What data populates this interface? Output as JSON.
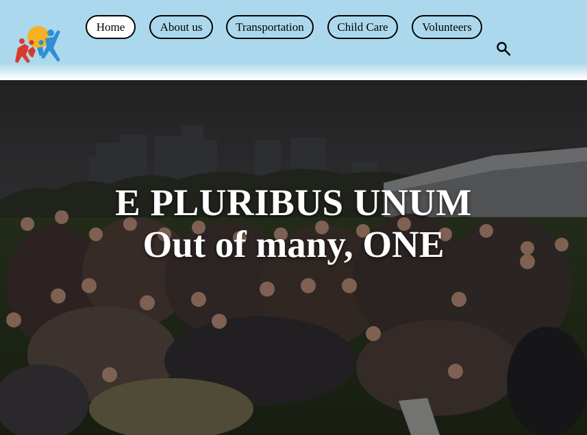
{
  "header": {
    "background": "#abd8ec",
    "logo": {
      "icon": "family-logo-icon",
      "colors": [
        "#f5b324",
        "#d93a2e",
        "#2f8fd6"
      ]
    },
    "nav": [
      {
        "label": "Home",
        "active": true
      },
      {
        "label": "About us",
        "active": false
      },
      {
        "label": "Transportation",
        "active": false
      },
      {
        "label": "Child Care",
        "active": false
      },
      {
        "label": "Volunteers",
        "active": false
      }
    ],
    "search_icon": "search-icon"
  },
  "hero": {
    "line1": "E PLURIBUS UNUM",
    "line2": "Out of many, ONE",
    "photo": "crowd-group-photo"
  }
}
